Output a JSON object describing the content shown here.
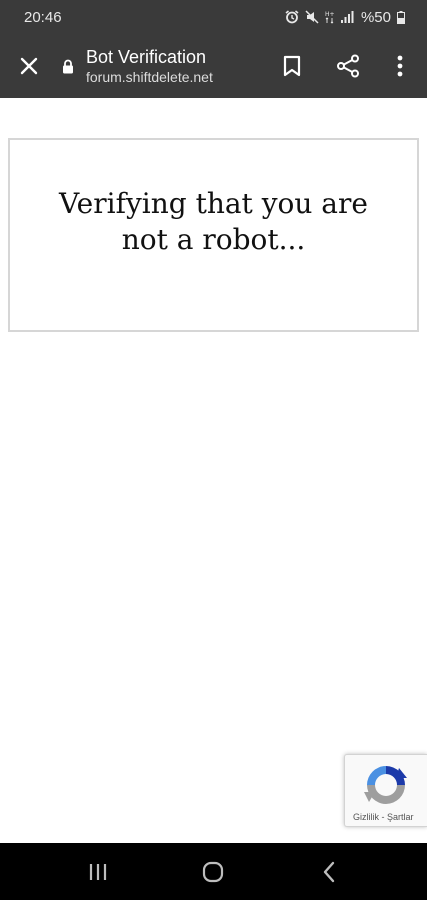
{
  "status_bar": {
    "time": "20:46",
    "battery_text": "%50",
    "icons": [
      "alarm-icon",
      "mute-icon",
      "data-icon",
      "signal-icon",
      "battery-icon"
    ]
  },
  "toolbar": {
    "title": "Bot Verification",
    "url": "forum.shiftdelete.net",
    "icons": [
      "close-icon",
      "lock-icon",
      "bookmark-icon",
      "share-icon",
      "more-vert-icon"
    ]
  },
  "content": {
    "verify_message": "Verifying that you are not a robot..."
  },
  "recaptcha": {
    "privacy_label": "Gizlilik",
    "separator": " - ",
    "terms_label": "Şartlar"
  },
  "nav_bar": {
    "icons": [
      "recents-icon",
      "home-icon",
      "back-icon"
    ]
  },
  "colors": {
    "bar_background": "#3a3a3a",
    "nav_background": "#000000",
    "box_border": "#d6d6d6"
  }
}
